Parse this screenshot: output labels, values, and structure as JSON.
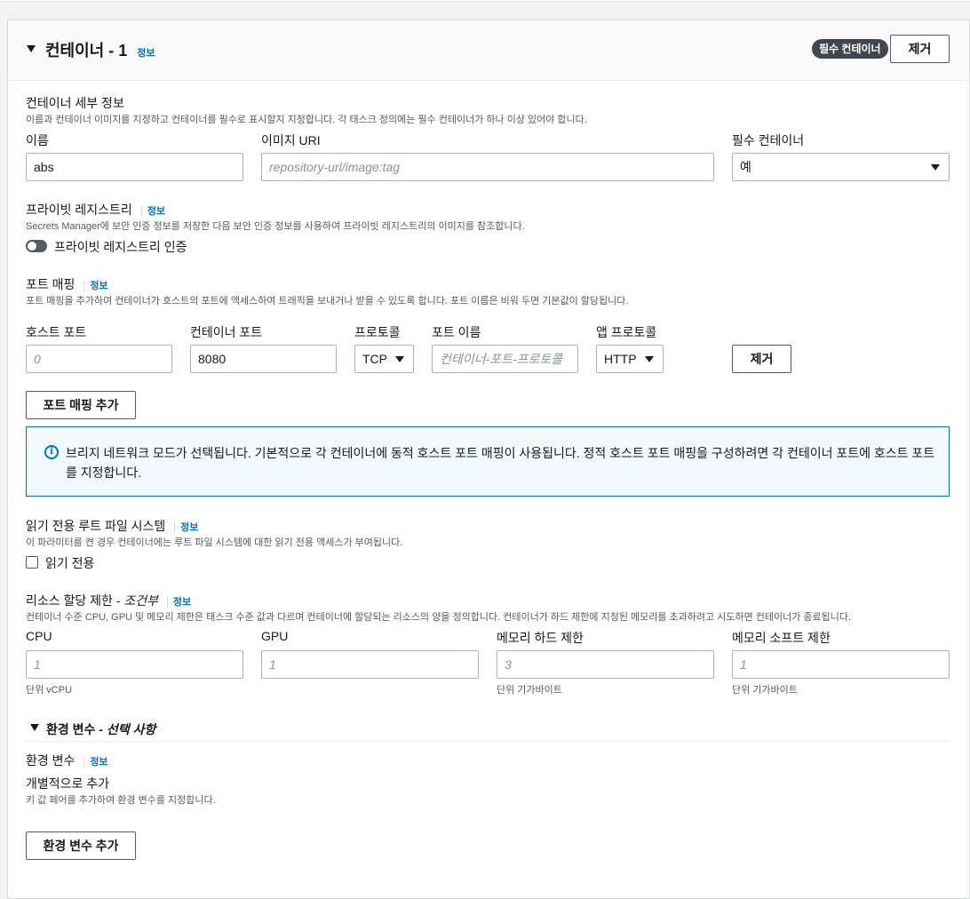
{
  "panel": {
    "title": "컨테이너 - 1",
    "info": "정보",
    "badge": "필수 컨테이너",
    "remove_label": "제거"
  },
  "details": {
    "heading": "컨테이너 세부 정보",
    "description": "이름과 컨테이너 이미지를 지정하고 컨테이너를 필수로 표시할지 지정합니다. 각 태스크 정의에는 필수 컨테이너가 하나 이상 있어야 합니다.",
    "name_label": "이름",
    "name_value": "abs",
    "image_label": "이미지 URI",
    "image_placeholder": "repository-url/image:tag",
    "essential_label": "필수 컨테이너",
    "essential_value": "예"
  },
  "private_registry": {
    "heading": "프라이빗 레지스트리",
    "info": "정보",
    "description": "Secrets Manager에 보안 인증 정보를 저장한 다음 보안 인증 정보를 사용하여 프라이빗 레지스트리의 이미지를 참조합니다.",
    "toggle_label": "프라이빗 레지스트리 인증",
    "toggle_on": false
  },
  "port_mapping": {
    "heading": "포트 매핑",
    "info": "정보",
    "description": "포트 매핑을 추가하여 컨테이너가 호스트의 포트에 액세스하여 트래픽을 보내거나 받을 수 있도록 합니다. 포트 이름은 비워 두면 기본값이 할당됩니다.",
    "host_port_label": "호스트 포트",
    "host_port_placeholder": "0",
    "container_port_label": "컨테이너 포트",
    "container_port_value": "8080",
    "protocol_label": "프로토콜",
    "protocol_value": "TCP",
    "port_name_label": "포트 이름",
    "port_name_placeholder": "컨테이너-포트-프로토콜",
    "app_protocol_label": "앱 프로토콜",
    "app_protocol_value": "HTTP",
    "remove_label": "제거",
    "add_label": "포트 매핑 추가"
  },
  "alert": {
    "icon": "info-icon",
    "text": "브리지 네트워크 모드가 선택됩니다. 기본적으로 각 컨테이너에 동적 호스트 포트 매핑이 사용됩니다. 정적 호스트 포트 매핑을 구성하려면 각 컨테이너 포트에 호스트 포트를 지정합니다."
  },
  "readonly_fs": {
    "heading": "읽기 전용 루트 파일 시스템",
    "info": "정보",
    "description": "이 파라미터를 켠 경우 컨테이너에는 루트 파일 시스템에 대한 읽기 전용 액세스가 부여됩니다.",
    "checkbox_label": "읽기 전용",
    "checked": false
  },
  "resources": {
    "heading": "리소스 할당 제한 - ",
    "heading_italic": "조건부",
    "info": "정보",
    "description": "컨테이너 수준 CPU, GPU 및 메모리 제한은 태스크 수준 값과 다르며 컨테이너에 할당되는 리소스의 양을 정의합니다. 컨테이너가 하드 제한에 지정된 메모리를 초과하려고 시도하면 컨테이너가 종료됩니다.",
    "cpu_label": "CPU",
    "cpu_placeholder": "1",
    "cpu_hint": "단위 vCPU",
    "gpu_label": "GPU",
    "gpu_placeholder": "1",
    "mem_hard_label": "메모리 하드 제한",
    "mem_hard_placeholder": "3",
    "mem_hard_hint": "단위 기가바이트",
    "mem_soft_label": "메모리 소프트 제한",
    "mem_soft_placeholder": "1",
    "mem_soft_hint": "단위 기가바이트"
  },
  "env": {
    "section_title": "환경 변수 - ",
    "section_title_italic": "선택 사항",
    "heading": "환경 변수",
    "info": "정보",
    "sub_heading": "개별적으로 추가",
    "description": "키 값 페어를 추가하여 환경 변수를 지정합니다.",
    "add_label": "환경 변수 추가"
  },
  "colors": {
    "link": "#0073bb",
    "badge_bg": "#414750",
    "alert_bg": "#f1faff",
    "alert_border": "#0073bb"
  }
}
